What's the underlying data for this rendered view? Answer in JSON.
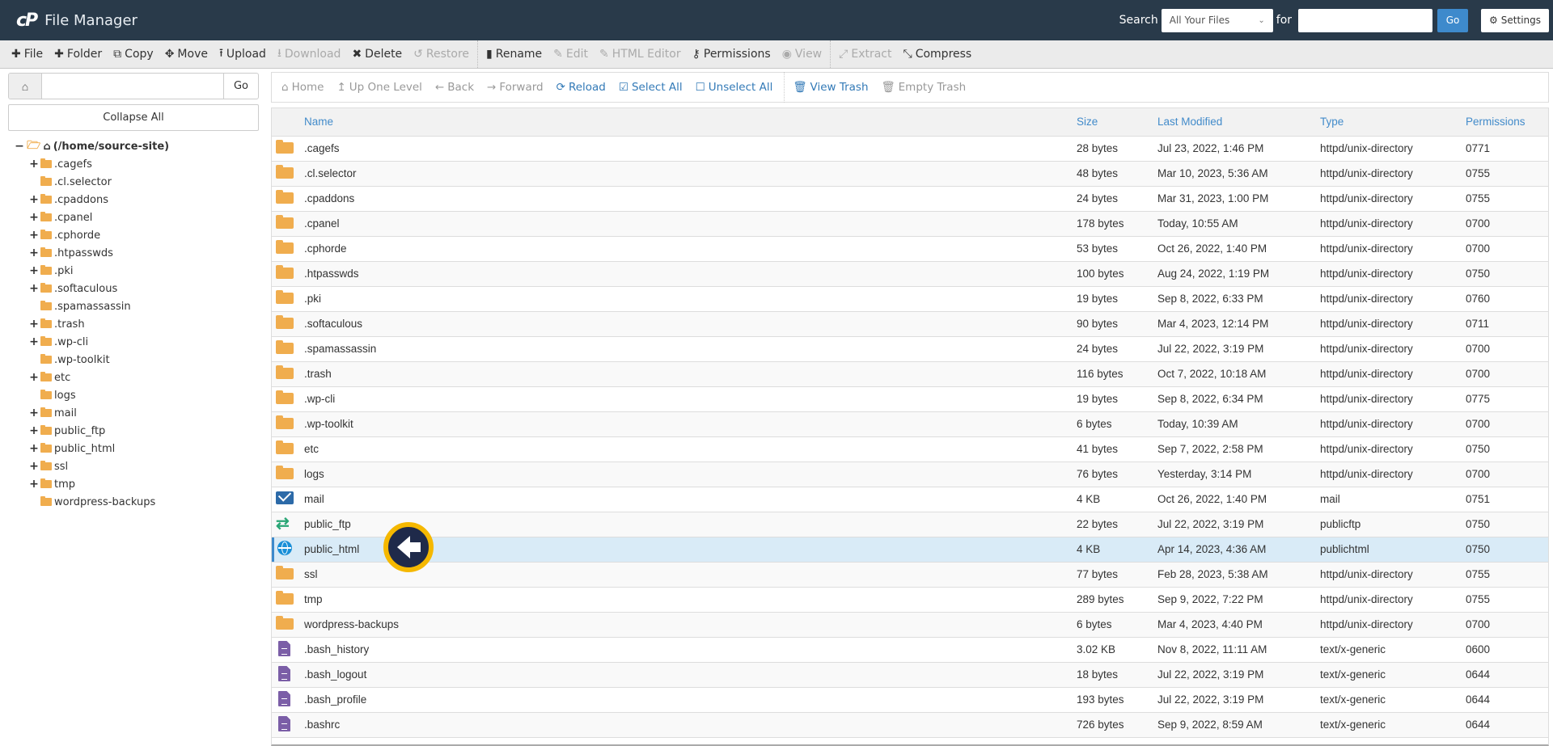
{
  "header": {
    "logo": "cP",
    "title": "File Manager",
    "search_label": "Search",
    "search_scope": "All Your Files",
    "for_label": "for",
    "search_value": "",
    "go_label": "Go",
    "settings_label": "Settings",
    "settings_icon": "gear-icon"
  },
  "toolbar": [
    {
      "label": "File",
      "icon": "✚",
      "name": "new-file",
      "disabled": false
    },
    {
      "label": "Folder",
      "icon": "✚",
      "name": "new-folder",
      "disabled": false
    },
    {
      "label": "Copy",
      "icon": "⧉",
      "name": "copy",
      "disabled": false
    },
    {
      "label": "Move",
      "icon": "✥",
      "name": "move",
      "disabled": false
    },
    {
      "label": "Upload",
      "icon": "⭱",
      "name": "upload",
      "disabled": false
    },
    {
      "label": "Download",
      "icon": "⭳",
      "name": "download",
      "disabled": true
    },
    {
      "label": "Delete",
      "icon": "✖",
      "name": "delete",
      "disabled": false
    },
    {
      "label": "Restore",
      "icon": "↺",
      "name": "restore",
      "disabled": true
    },
    {
      "label": "Rename",
      "icon": "▮",
      "name": "rename",
      "disabled": false,
      "sep_before": true
    },
    {
      "label": "Edit",
      "icon": "✎",
      "name": "edit",
      "disabled": true
    },
    {
      "label": "HTML Editor",
      "icon": "✎",
      "name": "html-editor",
      "disabled": true
    },
    {
      "label": "Permissions",
      "icon": "⚷",
      "name": "permissions",
      "disabled": false
    },
    {
      "label": "View",
      "icon": "◉",
      "name": "view",
      "disabled": true
    },
    {
      "label": "Extract",
      "icon": "⤢",
      "name": "extract",
      "disabled": true,
      "sep_before": true
    },
    {
      "label": "Compress",
      "icon": "⤡",
      "name": "compress",
      "disabled": false
    }
  ],
  "sidebar": {
    "path_value": "",
    "go_label": "Go",
    "collapse_label": "Collapse All",
    "root_label": "(/home/source-site)",
    "tree": [
      {
        "label": ".cagefs",
        "expandable": true
      },
      {
        "label": ".cl.selector",
        "expandable": false
      },
      {
        "label": ".cpaddons",
        "expandable": true
      },
      {
        "label": ".cpanel",
        "expandable": true
      },
      {
        "label": ".cphorde",
        "expandable": true
      },
      {
        "label": ".htpasswds",
        "expandable": true
      },
      {
        "label": ".pki",
        "expandable": true
      },
      {
        "label": ".softaculous",
        "expandable": true
      },
      {
        "label": ".spamassassin",
        "expandable": false
      },
      {
        "label": ".trash",
        "expandable": true
      },
      {
        "label": ".wp-cli",
        "expandable": true
      },
      {
        "label": ".wp-toolkit",
        "expandable": false
      },
      {
        "label": "etc",
        "expandable": true
      },
      {
        "label": "logs",
        "expandable": false
      },
      {
        "label": "mail",
        "expandable": true
      },
      {
        "label": "public_ftp",
        "expandable": true
      },
      {
        "label": "public_html",
        "expandable": true
      },
      {
        "label": "ssl",
        "expandable": true
      },
      {
        "label": "tmp",
        "expandable": true
      },
      {
        "label": "wordpress-backups",
        "expandable": false
      }
    ]
  },
  "nav": [
    {
      "label": "Home",
      "icon": "⌂",
      "name": "home",
      "active": false
    },
    {
      "label": "Up One Level",
      "icon": "↥",
      "name": "up-one-level",
      "active": false
    },
    {
      "label": "Back",
      "icon": "←",
      "name": "back",
      "active": false
    },
    {
      "label": "Forward",
      "icon": "→",
      "name": "forward",
      "active": false
    },
    {
      "label": "Reload",
      "icon": "⟳",
      "name": "reload",
      "active": true
    },
    {
      "label": "Select All",
      "icon": "☑",
      "name": "select-all",
      "active": true
    },
    {
      "label": "Unselect All",
      "icon": "☐",
      "name": "unselect-all",
      "active": true
    },
    {
      "label": "View Trash",
      "icon": "🗑",
      "name": "view-trash",
      "active": true,
      "sep_before": true
    },
    {
      "label": "Empty Trash",
      "icon": "🗑",
      "name": "empty-trash",
      "active": false
    }
  ],
  "table": {
    "columns": [
      "Name",
      "Size",
      "Last Modified",
      "Type",
      "Permissions"
    ],
    "rows": [
      {
        "icon": "folder",
        "name": ".cagefs",
        "size": "28 bytes",
        "modified": "Jul 23, 2022, 1:46 PM",
        "type": "httpd/unix-directory",
        "perms": "0771"
      },
      {
        "icon": "folder",
        "name": ".cl.selector",
        "size": "48 bytes",
        "modified": "Mar 10, 2023, 5:36 AM",
        "type": "httpd/unix-directory",
        "perms": "0755"
      },
      {
        "icon": "folder",
        "name": ".cpaddons",
        "size": "24 bytes",
        "modified": "Mar 31, 2023, 1:00 PM",
        "type": "httpd/unix-directory",
        "perms": "0755"
      },
      {
        "icon": "folder",
        "name": ".cpanel",
        "size": "178 bytes",
        "modified": "Today, 10:55 AM",
        "type": "httpd/unix-directory",
        "perms": "0700"
      },
      {
        "icon": "folder",
        "name": ".cphorde",
        "size": "53 bytes",
        "modified": "Oct 26, 2022, 1:40 PM",
        "type": "httpd/unix-directory",
        "perms": "0700"
      },
      {
        "icon": "folder",
        "name": ".htpasswds",
        "size": "100 bytes",
        "modified": "Aug 24, 2022, 1:19 PM",
        "type": "httpd/unix-directory",
        "perms": "0750"
      },
      {
        "icon": "folder",
        "name": ".pki",
        "size": "19 bytes",
        "modified": "Sep 8, 2022, 6:33 PM",
        "type": "httpd/unix-directory",
        "perms": "0760"
      },
      {
        "icon": "folder",
        "name": ".softaculous",
        "size": "90 bytes",
        "modified": "Mar 4, 2023, 12:14 PM",
        "type": "httpd/unix-directory",
        "perms": "0711"
      },
      {
        "icon": "folder",
        "name": ".spamassassin",
        "size": "24 bytes",
        "modified": "Jul 22, 2022, 3:19 PM",
        "type": "httpd/unix-directory",
        "perms": "0700"
      },
      {
        "icon": "folder",
        "name": ".trash",
        "size": "116 bytes",
        "modified": "Oct 7, 2022, 10:18 AM",
        "type": "httpd/unix-directory",
        "perms": "0700"
      },
      {
        "icon": "folder",
        "name": ".wp-cli",
        "size": "19 bytes",
        "modified": "Sep 8, 2022, 6:34 PM",
        "type": "httpd/unix-directory",
        "perms": "0775"
      },
      {
        "icon": "folder",
        "name": ".wp-toolkit",
        "size": "6 bytes",
        "modified": "Today, 10:39 AM",
        "type": "httpd/unix-directory",
        "perms": "0700"
      },
      {
        "icon": "folder",
        "name": "etc",
        "size": "41 bytes",
        "modified": "Sep 7, 2022, 2:58 PM",
        "type": "httpd/unix-directory",
        "perms": "0750"
      },
      {
        "icon": "folder",
        "name": "logs",
        "size": "76 bytes",
        "modified": "Yesterday, 3:14 PM",
        "type": "httpd/unix-directory",
        "perms": "0700"
      },
      {
        "icon": "mail",
        "name": "mail",
        "size": "4 KB",
        "modified": "Oct 26, 2022, 1:40 PM",
        "type": "mail",
        "perms": "0751"
      },
      {
        "icon": "ftp",
        "name": "public_ftp",
        "size": "22 bytes",
        "modified": "Jul 22, 2022, 3:19 PM",
        "type": "publicftp",
        "perms": "0750"
      },
      {
        "icon": "globe",
        "name": "public_html",
        "size": "4 KB",
        "modified": "Apr 14, 2023, 4:36 AM",
        "type": "publichtml",
        "perms": "0750",
        "selected": true
      },
      {
        "icon": "folder",
        "name": "ssl",
        "size": "77 bytes",
        "modified": "Feb 28, 2023, 5:38 AM",
        "type": "httpd/unix-directory",
        "perms": "0755"
      },
      {
        "icon": "folder",
        "name": "tmp",
        "size": "289 bytes",
        "modified": "Sep 9, 2022, 7:22 PM",
        "type": "httpd/unix-directory",
        "perms": "0755"
      },
      {
        "icon": "folder",
        "name": "wordpress-backups",
        "size": "6 bytes",
        "modified": "Mar 4, 2023, 4:40 PM",
        "type": "httpd/unix-directory",
        "perms": "0700"
      },
      {
        "icon": "doc",
        "name": ".bash_history",
        "size": "3.02 KB",
        "modified": "Nov 8, 2022, 11:11 AM",
        "type": "text/x-generic",
        "perms": "0600"
      },
      {
        "icon": "doc",
        "name": ".bash_logout",
        "size": "18 bytes",
        "modified": "Jul 22, 2022, 3:19 PM",
        "type": "text/x-generic",
        "perms": "0644"
      },
      {
        "icon": "doc",
        "name": ".bash_profile",
        "size": "193 bytes",
        "modified": "Jul 22, 2022, 3:19 PM",
        "type": "text/x-generic",
        "perms": "0644"
      },
      {
        "icon": "doc",
        "name": ".bashrc",
        "size": "726 bytes",
        "modified": "Sep 9, 2022, 8:59 AM",
        "type": "text/x-generic",
        "perms": "0644"
      }
    ]
  },
  "colors": {
    "header_bg": "#293a4a",
    "accent": "#3e8acc",
    "link": "#428bca",
    "folder": "#f0ad4e",
    "selected_row": "#d9ebf7",
    "cursor_ring": "#f5b800"
  }
}
